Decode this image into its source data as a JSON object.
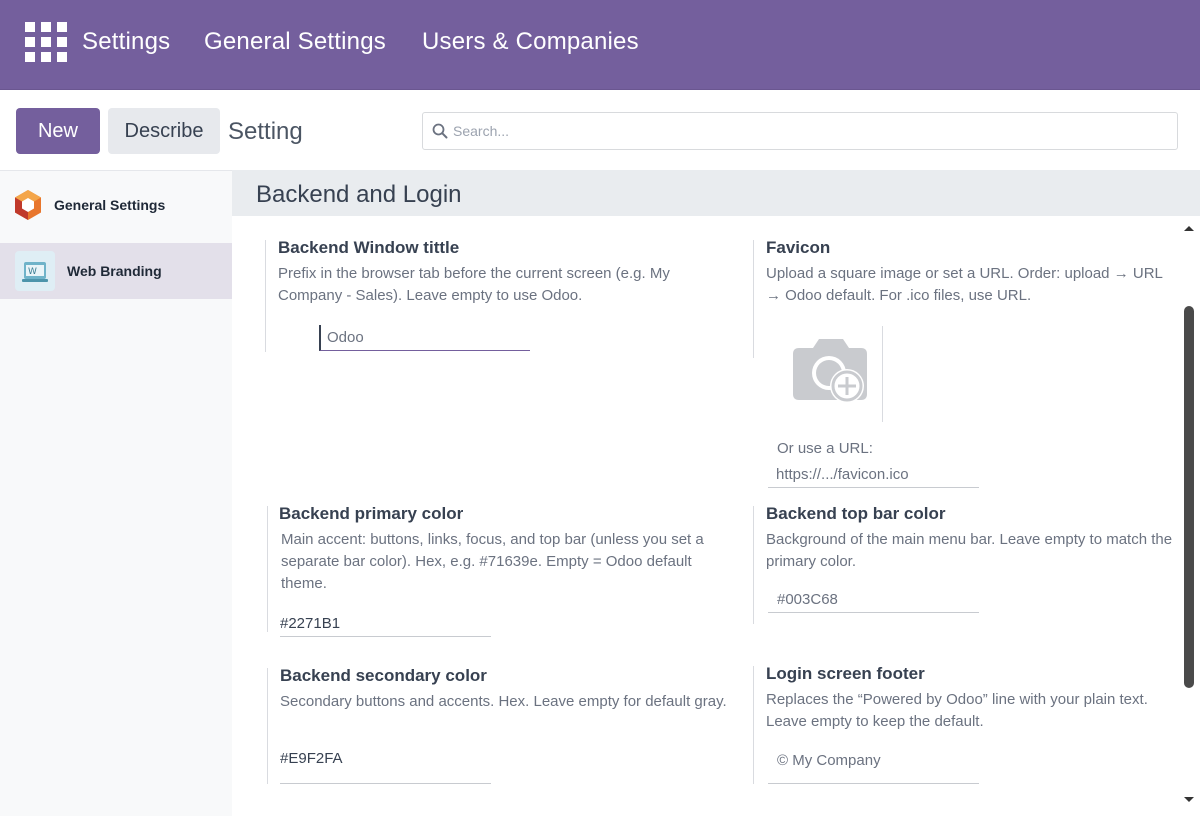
{
  "topbar": {
    "app_name": "Settings",
    "menu": [
      "General Settings",
      "Users & Companies"
    ]
  },
  "control_panel": {
    "new_label": "New",
    "describe_label": "Describe",
    "page_title": "Setting",
    "search_placeholder": "Search..."
  },
  "sidebar": {
    "items": [
      {
        "label": "General Settings",
        "icon": "odoo-logo-icon",
        "active": false
      },
      {
        "label": "Web Branding",
        "icon": "web-branding-icon",
        "active": true
      }
    ]
  },
  "section": {
    "title": "Backend and Login"
  },
  "settings": {
    "window_title": {
      "title": "Backend Window tittle",
      "desc": "Prefix in the browser tab before the current screen (e.g. My Company - Sales). Leave empty to use Odoo.",
      "placeholder": "Odoo",
      "value": ""
    },
    "favicon": {
      "title": "Favicon",
      "desc": "Upload a square image or set a URL. Order: upload → URL → Odoo default. For .ico files, use URL.",
      "url_label": "Or use a URL:",
      "url_placeholder": "https://.../favicon.ico"
    },
    "primary_color": {
      "title": "Backend primary color",
      "desc": "Main accent: buttons, links, focus, and top bar (unless you set a separate bar color). Hex, e.g. #71639e. Empty = Odoo default theme.",
      "value": "#2271B1"
    },
    "top_bar_color": {
      "title": "Backend top bar color",
      "desc": "Background of the main menu bar. Leave empty to match the primary color.",
      "placeholder": "#003C68"
    },
    "secondary_color": {
      "title": "Backend secondary color",
      "desc": "Secondary buttons and accents. Hex. Leave empty for default gray.",
      "value": "#E9F2FA"
    },
    "login_footer": {
      "title": "Login screen footer",
      "desc": "Replaces the “Powered by Odoo” line with your plain text. Leave empty to keep the default.",
      "placeholder": "© My Company"
    }
  },
  "colors": {
    "brand": "#745f9d",
    "sidebar_active": "#e3e0ea",
    "section_header": "#e9ecef"
  }
}
